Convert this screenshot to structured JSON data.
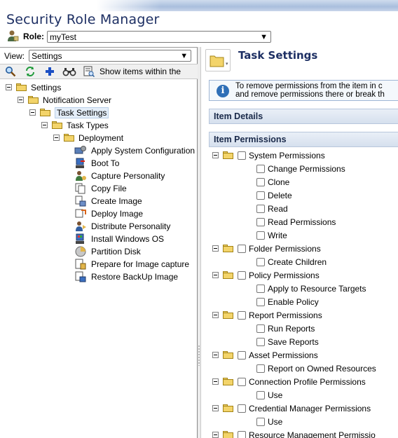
{
  "app": {
    "title": "Security Role Manager"
  },
  "role": {
    "label": "Role:",
    "selected": "myTest"
  },
  "left_panel": {
    "view_label": "View:",
    "view_selected": "Settings",
    "toolbar": {
      "show_items_text": "Show items within the"
    },
    "tree": [
      {
        "label": "Settings",
        "level": 0,
        "type": "folder",
        "expander": true
      },
      {
        "label": "Notification Server",
        "level": 1,
        "type": "folder",
        "expander": true
      },
      {
        "label": "Task Settings",
        "level": 2,
        "type": "folder",
        "expander": true,
        "selected": true
      },
      {
        "label": "Task Types",
        "level": 3,
        "type": "folder",
        "expander": true
      },
      {
        "label": "Deployment",
        "level": 4,
        "type": "folder",
        "expander": true
      },
      {
        "label": "Apply System Configuration",
        "level": 5,
        "type": "task",
        "icon": "system-config-icon"
      },
      {
        "label": "Boot To",
        "level": 5,
        "type": "task",
        "icon": "boot-to-icon"
      },
      {
        "label": "Capture Personality",
        "level": 5,
        "type": "task",
        "icon": "capture-personality-icon"
      },
      {
        "label": "Copy File",
        "level": 5,
        "type": "task",
        "icon": "copy-file-icon"
      },
      {
        "label": "Create Image",
        "level": 5,
        "type": "task",
        "icon": "create-image-icon"
      },
      {
        "label": "Deploy Image",
        "level": 5,
        "type": "task",
        "icon": "deploy-image-icon"
      },
      {
        "label": "Distribute Personality",
        "level": 5,
        "type": "task",
        "icon": "distribute-personality-icon"
      },
      {
        "label": "Install Windows OS",
        "level": 5,
        "type": "task",
        "icon": "install-windows-icon"
      },
      {
        "label": "Partition Disk",
        "level": 5,
        "type": "task",
        "icon": "partition-disk-icon"
      },
      {
        "label": "Prepare for Image capture",
        "level": 5,
        "type": "task",
        "icon": "prepare-image-icon"
      },
      {
        "label": "Restore BackUp Image",
        "level": 5,
        "type": "task",
        "icon": "restore-backup-icon"
      }
    ]
  },
  "right_panel": {
    "title": "Task Settings",
    "info_line1": "To remove permissions from the item in c",
    "info_line2": "and remove permissions there or break th",
    "item_details_header": "Item Details",
    "item_permissions_header": "Item Permissions",
    "permissions": [
      {
        "group": "System Permissions",
        "items": [
          "Change Permissions",
          "Clone",
          "Delete",
          "Read",
          "Read Permissions",
          "Write"
        ]
      },
      {
        "group": "Folder Permissions",
        "items": [
          "Create Children"
        ]
      },
      {
        "group": "Policy Permissions",
        "items": [
          "Apply to Resource Targets",
          "Enable Policy"
        ]
      },
      {
        "group": "Report Permissions",
        "items": [
          "Run Reports",
          "Save Reports"
        ]
      },
      {
        "group": "Asset Permissions",
        "items": [
          "Report on Owned Resources"
        ]
      },
      {
        "group": "Connection Profile Permissions",
        "items": [
          "Use"
        ]
      },
      {
        "group": "Credential Manager Permissions",
        "items": [
          "Use"
        ]
      },
      {
        "group": "Resource Management Permissio",
        "items": []
      }
    ]
  },
  "colors": {
    "title": "#1d2f63",
    "folder": "#f3d46a",
    "header_bg": "#d6e0ee"
  }
}
